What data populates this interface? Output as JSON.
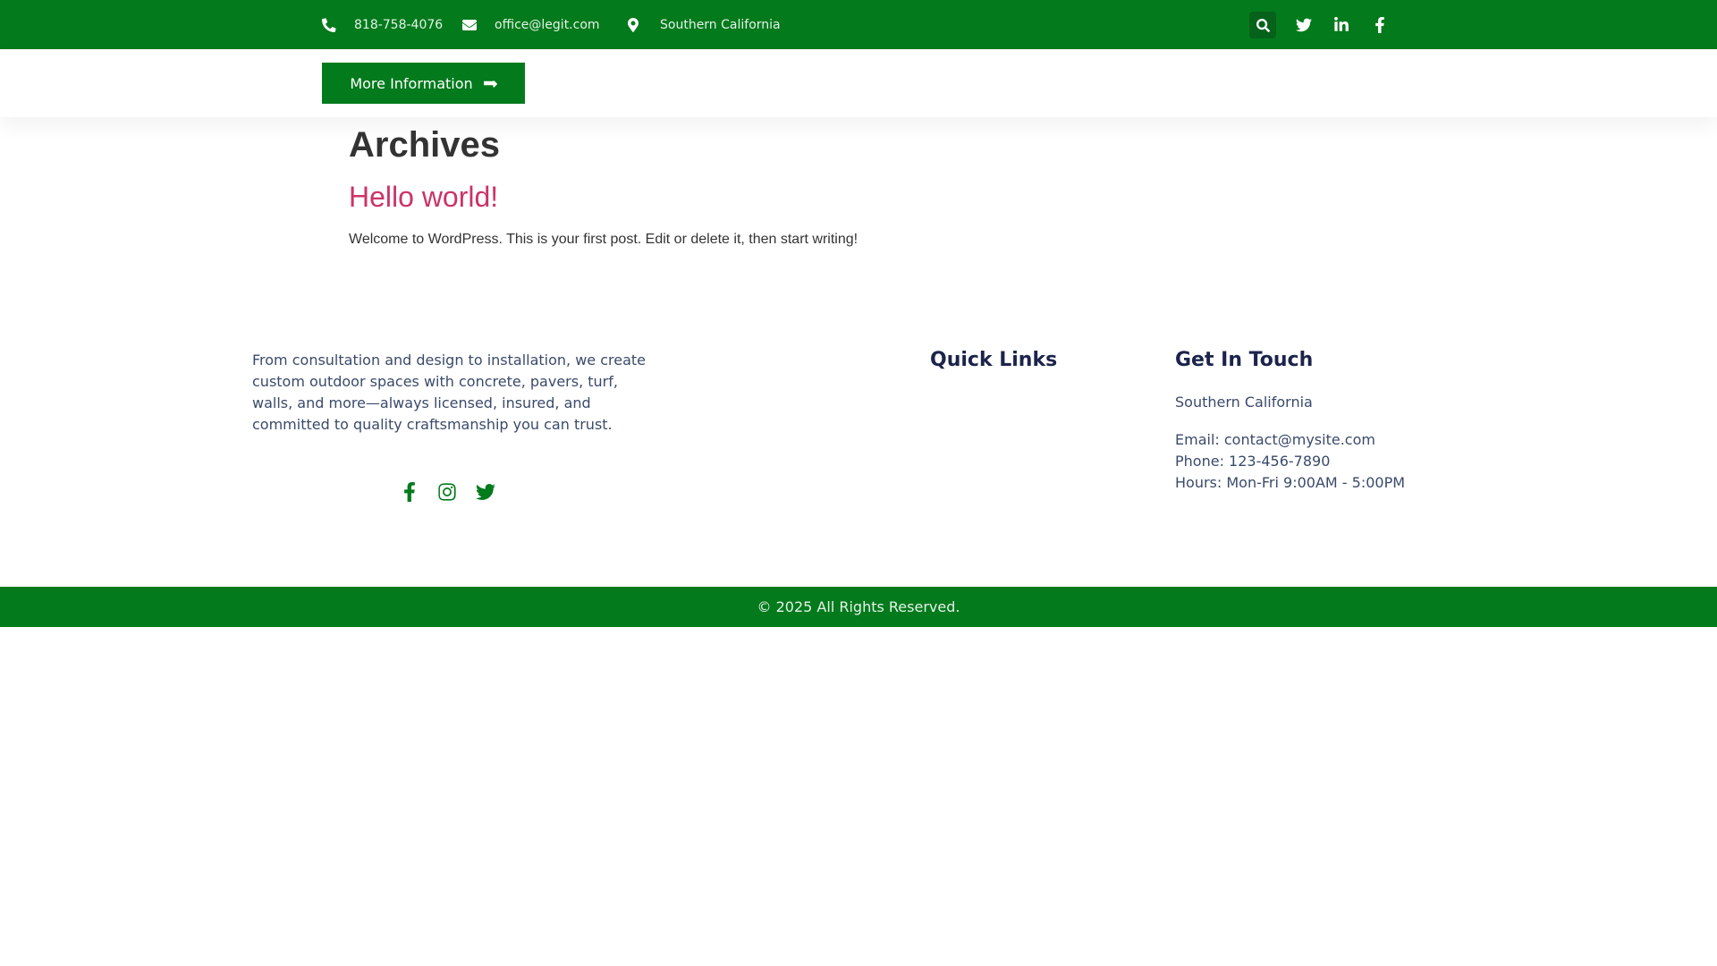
{
  "topbar": {
    "phone": "818-758-4076",
    "email": "office@legit.com",
    "location": "Southern California",
    "icons": [
      "phone-icon",
      "envelope-icon",
      "map-marker-icon",
      "search-icon",
      "twitter-icon",
      "linkedin-icon",
      "facebook-icon"
    ],
    "color": "#037a1c"
  },
  "nav": {
    "more_button_label": "More Information"
  },
  "archive": {
    "title": "Archives",
    "post_title": "Hello world!",
    "post_excerpt": "Welcome to WordPress. This is your first post. Edit or delete it, then start writing!",
    "post_title_color": "#cc3366"
  },
  "footer": {
    "about_text": "From consultation and design to installation, we create custom outdoor spaces with concrete, pavers, turf, walls, and more—always licensed, insured, and committed to quality craftsmanship you can trust.",
    "social_icons": [
      "facebook-icon",
      "instagram-icon",
      "twitter-icon"
    ],
    "quick_links_heading": "Quick Links",
    "get_in_touch_heading": "Get In Touch",
    "location": "Southern California",
    "email_line": "Email: contact@mysite.com",
    "phone_line": "Phone: 123-456-7890",
    "hours_line": "Hours: Mon-Fri 9:00AM - 5:00PM",
    "copyright": "© 2025 All Rights Reserved."
  }
}
